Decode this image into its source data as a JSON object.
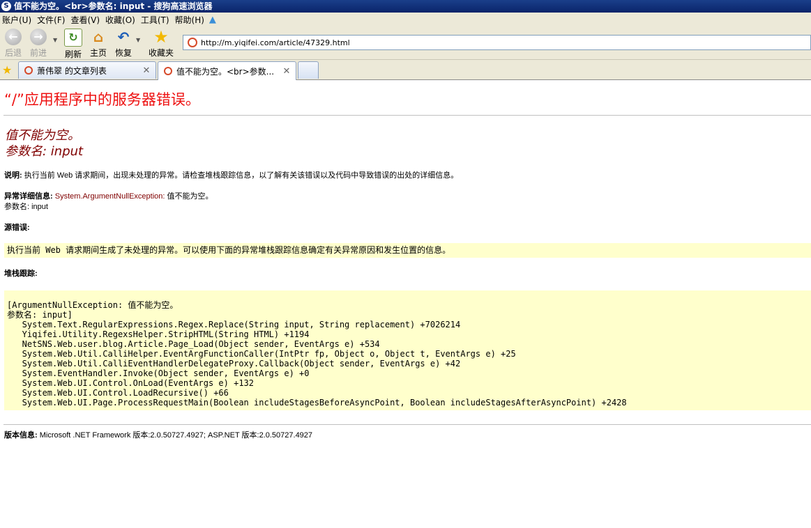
{
  "window": {
    "title": "值不能为空。<br>参数名: input - 搜狗高速浏览器",
    "app_icon": "S"
  },
  "menu": {
    "items": [
      "账户(U)",
      "文件(F)",
      "查看(V)",
      "收藏(O)",
      "工具(T)",
      "帮助(H)"
    ],
    "extra_icon": "shirt-icon"
  },
  "toolbar": {
    "back": "后退",
    "forward": "前进",
    "refresh": "刷新",
    "home": "主页",
    "restore": "恢复",
    "favorites": "收藏夹"
  },
  "address": {
    "url": "http://m.yiqifei.com/article/47329.html"
  },
  "tabs": [
    {
      "label": "萧伟翠 的文章列表",
      "active": false
    },
    {
      "label": "值不能为空。<br>参数...",
      "active": true
    }
  ],
  "page": {
    "title": "“/”应用程序中的服务器错误。",
    "error_line1": "值不能为空。",
    "error_line2": "参数名: input",
    "desc_label": "说明:",
    "desc_text": " 执行当前 Web 请求期间，出现未处理的异常。请检查堆栈跟踪信息，以了解有关该错误以及代码中导致错误的出处的详细信息。",
    "ex_label": "异常详细信息:",
    "ex_type": " System.ArgumentNullException:",
    "ex_msg": " 值不能为空。",
    "ex_param": "参数名: input",
    "source_label": "源错误:",
    "source_text": "执行当前 Web 请求期间生成了未处理的异常。可以使用下面的异常堆栈跟踪信息确定有关异常原因和发生位置的信息。",
    "stack_label": "堆栈跟踪:",
    "stack_lines": [
      "[ArgumentNullException: 值不能为空。",
      "参数名: input]",
      "   System.Text.RegularExpressions.Regex.Replace(String input, String replacement) +7026214",
      "   Yiqifei.Utility.RegexsHelper.StripHTML(String HTML) +1194",
      "   NetSNS.Web.user.blog.Article.Page_Load(Object sender, EventArgs e) +534",
      "   System.Web.Util.CalliHelper.EventArgFunctionCaller(IntPtr fp, Object o, Object t, EventArgs e) +25",
      "   System.Web.Util.CalliEventHandlerDelegateProxy.Callback(Object sender, EventArgs e) +42",
      "   System.EventHandler.Invoke(Object sender, EventArgs e) +0",
      "   System.Web.UI.Control.OnLoad(EventArgs e) +132",
      "   System.Web.UI.Control.LoadRecursive() +66",
      "   System.Web.UI.Page.ProcessRequestMain(Boolean includeStagesBeforeAsyncPoint, Boolean includeStagesAfterAsyncPoint) +2428"
    ],
    "version_label": "版本信息:",
    "version_text": " Microsoft .NET Framework 版本:2.0.50727.4927; ASP.NET 版本:2.0.50727.4927"
  },
  "colors": {
    "title_red": "#ee1111",
    "error_maroon": "#800000",
    "code_bg": "#ffffcc",
    "chrome_bg": "#ece9d8"
  }
}
